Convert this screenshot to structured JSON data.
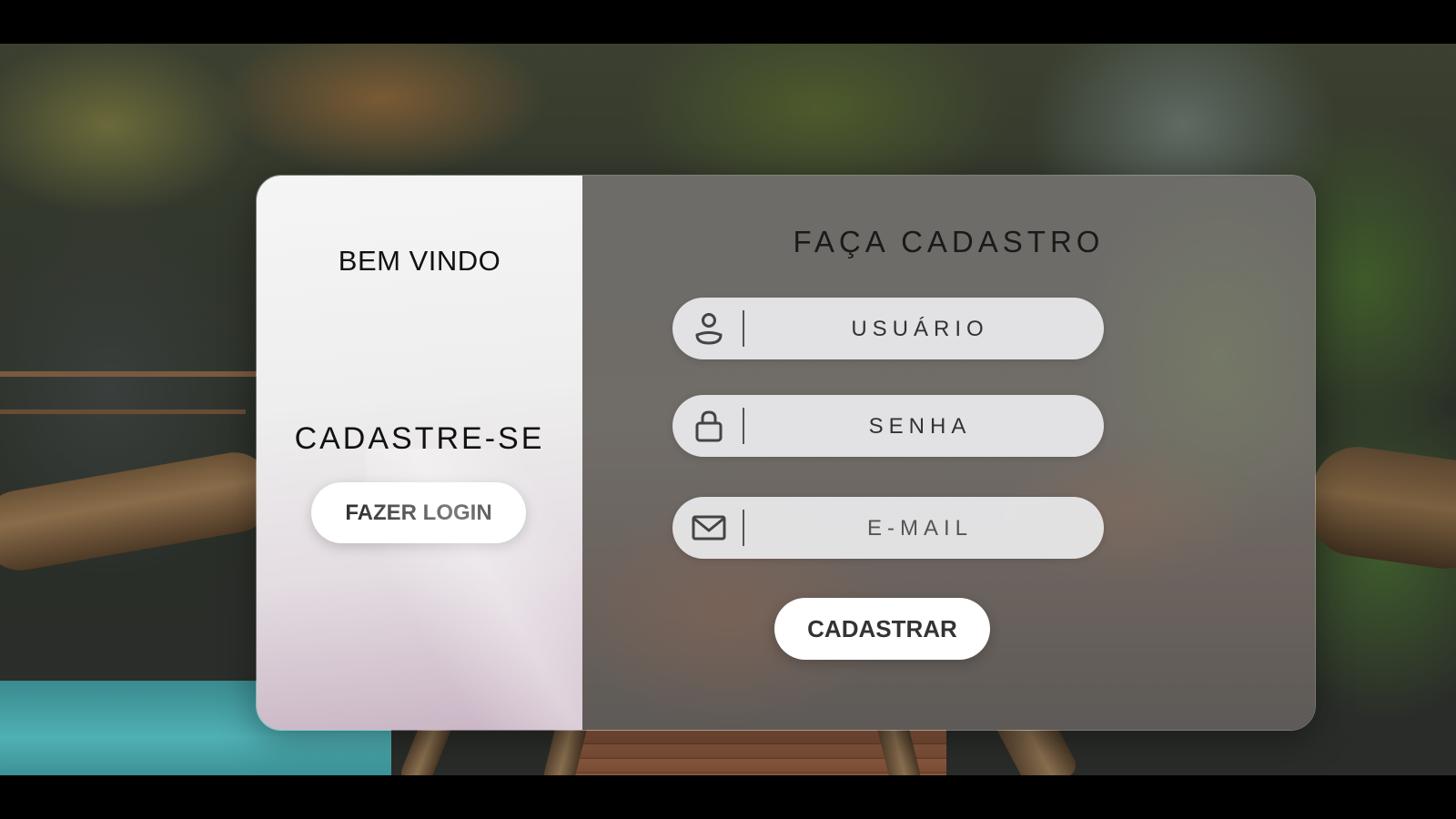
{
  "welcome_panel": {
    "title": "BEM VINDO",
    "signup_heading": "CADASTRE-SE",
    "login_button_label": "FAZER LOGIN"
  },
  "signup_form": {
    "title": "FAÇA CADASTRO",
    "fields": {
      "username": {
        "placeholder": "USUÁRIO",
        "value": "",
        "icon": "user-icon"
      },
      "password": {
        "placeholder": "SENHA",
        "value": "",
        "icon": "lock-icon"
      },
      "email": {
        "placeholder": "E-MAIL",
        "value": "",
        "icon": "mail-icon"
      }
    },
    "submit_label": "CADASTRAR"
  },
  "colors": {
    "left_panel": "#f0f0f0",
    "right_panel_tint": "#6d6c69",
    "button_bg": "#ffffff",
    "button_text": "#333333"
  }
}
